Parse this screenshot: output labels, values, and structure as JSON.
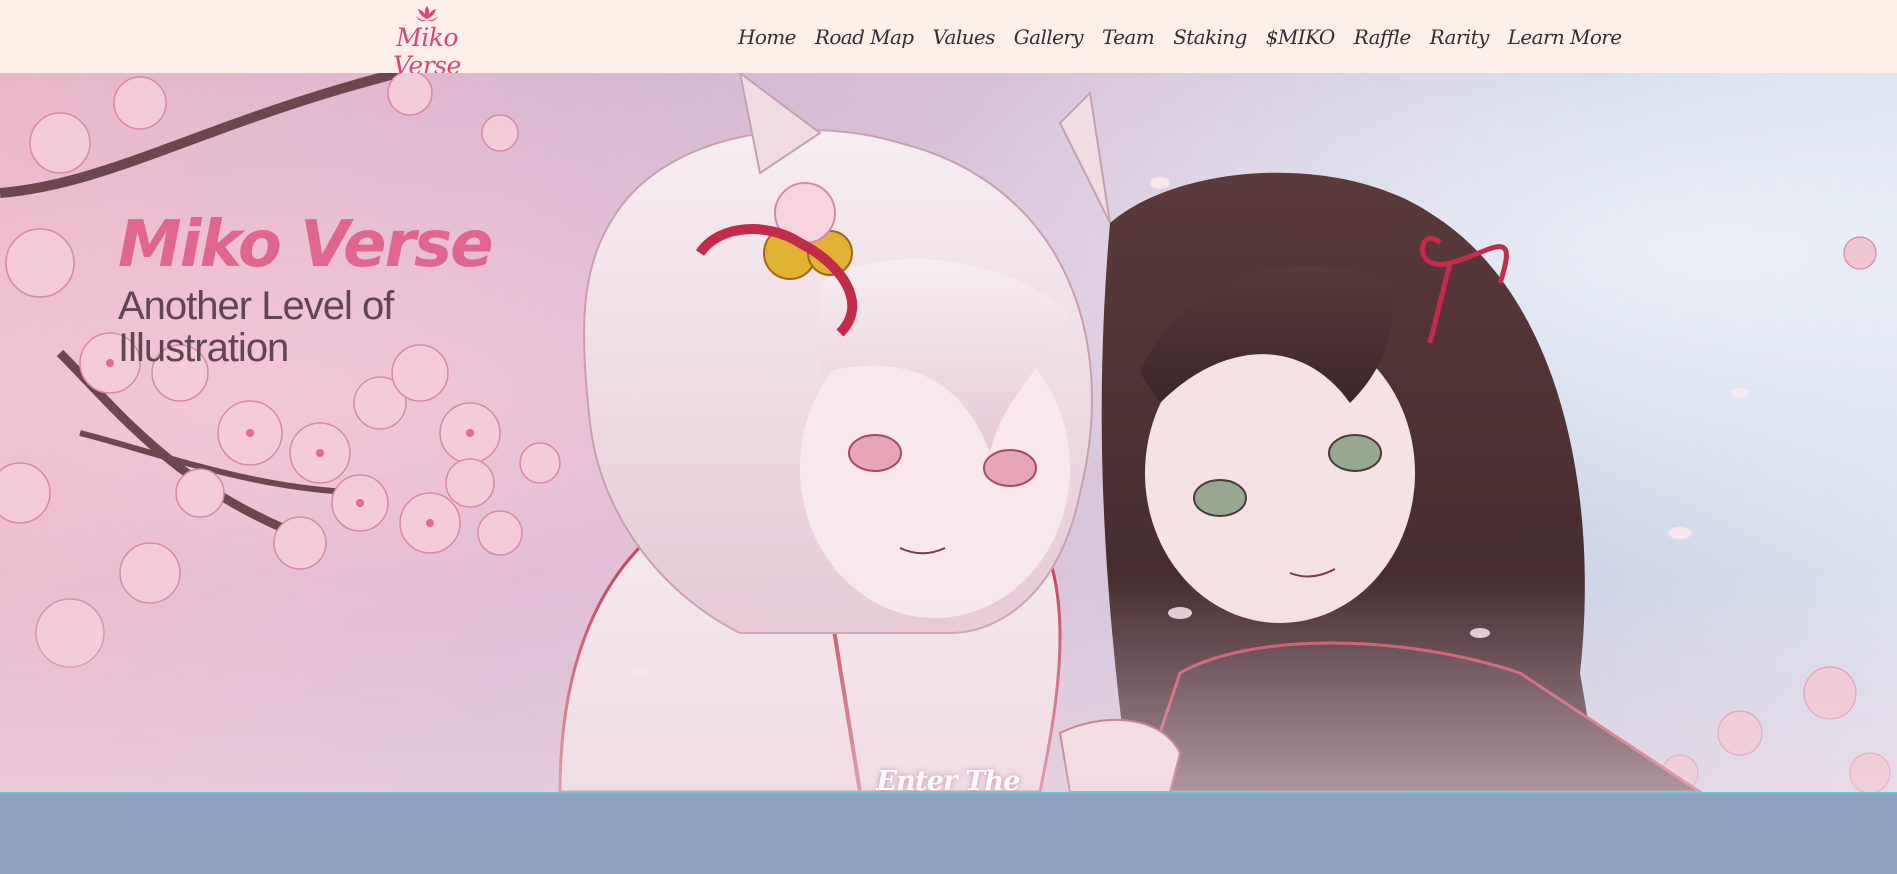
{
  "header": {
    "logo_text": "Miko Verse",
    "logo_icon": "lotus-icon",
    "background": "#fef0e8",
    "nav": [
      {
        "label": "Home"
      },
      {
        "label": "Road Map"
      },
      {
        "label": "Values"
      },
      {
        "label": "Gallery"
      },
      {
        "label": "Team"
      },
      {
        "label": "Staking"
      },
      {
        "label": "$MIKO"
      },
      {
        "label": "Raffle"
      },
      {
        "label": "Rarity"
      },
      {
        "label": "Learn More"
      }
    ]
  },
  "hero": {
    "title": "Miko Verse",
    "subtitle": "Another Level of Illustration",
    "cta_label": "Enter The MikoVerse",
    "title_color": "#e0668f",
    "subtitle_color": "#5f4652"
  },
  "colors": {
    "accent": "#e0447e",
    "footer_band": "#8fa2c0",
    "divider": "#5ec9d4"
  }
}
